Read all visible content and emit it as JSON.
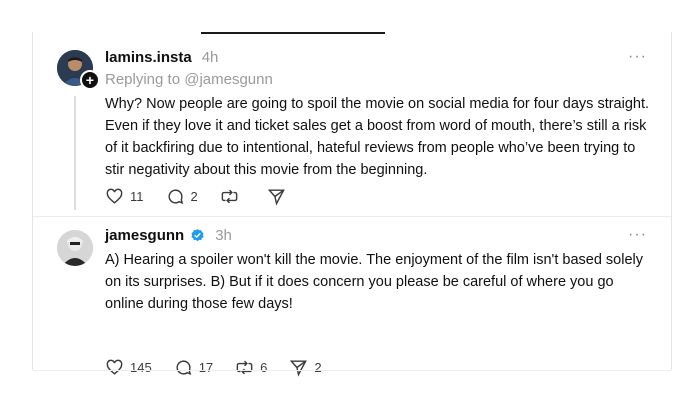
{
  "post1": {
    "username": "lamins.insta",
    "time": "4h",
    "reply_prefix": "Replying to",
    "reply_handle": "@jamesgunn",
    "text": "Why? Now people are going to spoil the movie on social media for four days straight. Even if they love it and ticket sales get a boost from word of mouth, there’s still a risk of it backfiring due to intentional, hateful reviews from people who’ve been trying to stir negativity about this movie from the beginning.",
    "likes": "11",
    "replies": "2",
    "reposts": "",
    "shares": "",
    "more": "···",
    "follow": "+"
  },
  "post2": {
    "username": "jamesgunn",
    "time": "3h",
    "text": "A) Hearing a spoiler won't kill the movie. The enjoyment of the film isn't based solely on its surprises. B) But if it does concern you please be careful of where you go online during those few days!",
    "likes": "145",
    "replies": "17",
    "reposts": "6",
    "shares": "2",
    "more": "···"
  },
  "colors": {
    "verified": "#1d9bf0",
    "muted": "#9a9a9a"
  }
}
